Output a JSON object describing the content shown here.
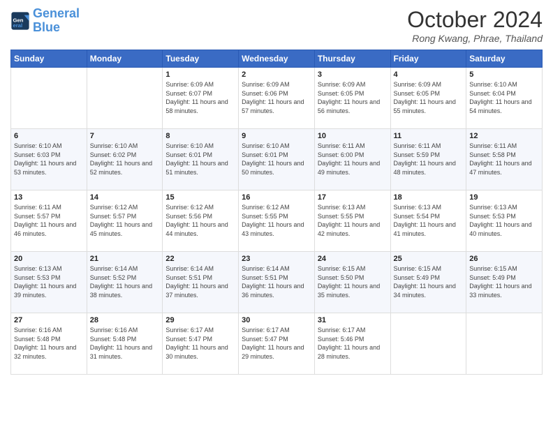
{
  "header": {
    "logo_general": "General",
    "logo_blue": "Blue",
    "month": "October 2024",
    "location": "Rong Kwang, Phrae, Thailand"
  },
  "weekdays": [
    "Sunday",
    "Monday",
    "Tuesday",
    "Wednesday",
    "Thursday",
    "Friday",
    "Saturday"
  ],
  "weeks": [
    [
      {
        "day": "",
        "sunrise": "",
        "sunset": "",
        "daylight": ""
      },
      {
        "day": "",
        "sunrise": "",
        "sunset": "",
        "daylight": ""
      },
      {
        "day": "1",
        "sunrise": "Sunrise: 6:09 AM",
        "sunset": "Sunset: 6:07 PM",
        "daylight": "Daylight: 11 hours and 58 minutes."
      },
      {
        "day": "2",
        "sunrise": "Sunrise: 6:09 AM",
        "sunset": "Sunset: 6:06 PM",
        "daylight": "Daylight: 11 hours and 57 minutes."
      },
      {
        "day": "3",
        "sunrise": "Sunrise: 6:09 AM",
        "sunset": "Sunset: 6:05 PM",
        "daylight": "Daylight: 11 hours and 56 minutes."
      },
      {
        "day": "4",
        "sunrise": "Sunrise: 6:09 AM",
        "sunset": "Sunset: 6:05 PM",
        "daylight": "Daylight: 11 hours and 55 minutes."
      },
      {
        "day": "5",
        "sunrise": "Sunrise: 6:10 AM",
        "sunset": "Sunset: 6:04 PM",
        "daylight": "Daylight: 11 hours and 54 minutes."
      }
    ],
    [
      {
        "day": "6",
        "sunrise": "Sunrise: 6:10 AM",
        "sunset": "Sunset: 6:03 PM",
        "daylight": "Daylight: 11 hours and 53 minutes."
      },
      {
        "day": "7",
        "sunrise": "Sunrise: 6:10 AM",
        "sunset": "Sunset: 6:02 PM",
        "daylight": "Daylight: 11 hours and 52 minutes."
      },
      {
        "day": "8",
        "sunrise": "Sunrise: 6:10 AM",
        "sunset": "Sunset: 6:01 PM",
        "daylight": "Daylight: 11 hours and 51 minutes."
      },
      {
        "day": "9",
        "sunrise": "Sunrise: 6:10 AM",
        "sunset": "Sunset: 6:01 PM",
        "daylight": "Daylight: 11 hours and 50 minutes."
      },
      {
        "day": "10",
        "sunrise": "Sunrise: 6:11 AM",
        "sunset": "Sunset: 6:00 PM",
        "daylight": "Daylight: 11 hours and 49 minutes."
      },
      {
        "day": "11",
        "sunrise": "Sunrise: 6:11 AM",
        "sunset": "Sunset: 5:59 PM",
        "daylight": "Daylight: 11 hours and 48 minutes."
      },
      {
        "day": "12",
        "sunrise": "Sunrise: 6:11 AM",
        "sunset": "Sunset: 5:58 PM",
        "daylight": "Daylight: 11 hours and 47 minutes."
      }
    ],
    [
      {
        "day": "13",
        "sunrise": "Sunrise: 6:11 AM",
        "sunset": "Sunset: 5:57 PM",
        "daylight": "Daylight: 11 hours and 46 minutes."
      },
      {
        "day": "14",
        "sunrise": "Sunrise: 6:12 AM",
        "sunset": "Sunset: 5:57 PM",
        "daylight": "Daylight: 11 hours and 45 minutes."
      },
      {
        "day": "15",
        "sunrise": "Sunrise: 6:12 AM",
        "sunset": "Sunset: 5:56 PM",
        "daylight": "Daylight: 11 hours and 44 minutes."
      },
      {
        "day": "16",
        "sunrise": "Sunrise: 6:12 AM",
        "sunset": "Sunset: 5:55 PM",
        "daylight": "Daylight: 11 hours and 43 minutes."
      },
      {
        "day": "17",
        "sunrise": "Sunrise: 6:13 AM",
        "sunset": "Sunset: 5:55 PM",
        "daylight": "Daylight: 11 hours and 42 minutes."
      },
      {
        "day": "18",
        "sunrise": "Sunrise: 6:13 AM",
        "sunset": "Sunset: 5:54 PM",
        "daylight": "Daylight: 11 hours and 41 minutes."
      },
      {
        "day": "19",
        "sunrise": "Sunrise: 6:13 AM",
        "sunset": "Sunset: 5:53 PM",
        "daylight": "Daylight: 11 hours and 40 minutes."
      }
    ],
    [
      {
        "day": "20",
        "sunrise": "Sunrise: 6:13 AM",
        "sunset": "Sunset: 5:53 PM",
        "daylight": "Daylight: 11 hours and 39 minutes."
      },
      {
        "day": "21",
        "sunrise": "Sunrise: 6:14 AM",
        "sunset": "Sunset: 5:52 PM",
        "daylight": "Daylight: 11 hours and 38 minutes."
      },
      {
        "day": "22",
        "sunrise": "Sunrise: 6:14 AM",
        "sunset": "Sunset: 5:51 PM",
        "daylight": "Daylight: 11 hours and 37 minutes."
      },
      {
        "day": "23",
        "sunrise": "Sunrise: 6:14 AM",
        "sunset": "Sunset: 5:51 PM",
        "daylight": "Daylight: 11 hours and 36 minutes."
      },
      {
        "day": "24",
        "sunrise": "Sunrise: 6:15 AM",
        "sunset": "Sunset: 5:50 PM",
        "daylight": "Daylight: 11 hours and 35 minutes."
      },
      {
        "day": "25",
        "sunrise": "Sunrise: 6:15 AM",
        "sunset": "Sunset: 5:49 PM",
        "daylight": "Daylight: 11 hours and 34 minutes."
      },
      {
        "day": "26",
        "sunrise": "Sunrise: 6:15 AM",
        "sunset": "Sunset: 5:49 PM",
        "daylight": "Daylight: 11 hours and 33 minutes."
      }
    ],
    [
      {
        "day": "27",
        "sunrise": "Sunrise: 6:16 AM",
        "sunset": "Sunset: 5:48 PM",
        "daylight": "Daylight: 11 hours and 32 minutes."
      },
      {
        "day": "28",
        "sunrise": "Sunrise: 6:16 AM",
        "sunset": "Sunset: 5:48 PM",
        "daylight": "Daylight: 11 hours and 31 minutes."
      },
      {
        "day": "29",
        "sunrise": "Sunrise: 6:17 AM",
        "sunset": "Sunset: 5:47 PM",
        "daylight": "Daylight: 11 hours and 30 minutes."
      },
      {
        "day": "30",
        "sunrise": "Sunrise: 6:17 AM",
        "sunset": "Sunset: 5:47 PM",
        "daylight": "Daylight: 11 hours and 29 minutes."
      },
      {
        "day": "31",
        "sunrise": "Sunrise: 6:17 AM",
        "sunset": "Sunset: 5:46 PM",
        "daylight": "Daylight: 11 hours and 28 minutes."
      },
      {
        "day": "",
        "sunrise": "",
        "sunset": "",
        "daylight": ""
      },
      {
        "day": "",
        "sunrise": "",
        "sunset": "",
        "daylight": ""
      }
    ]
  ]
}
